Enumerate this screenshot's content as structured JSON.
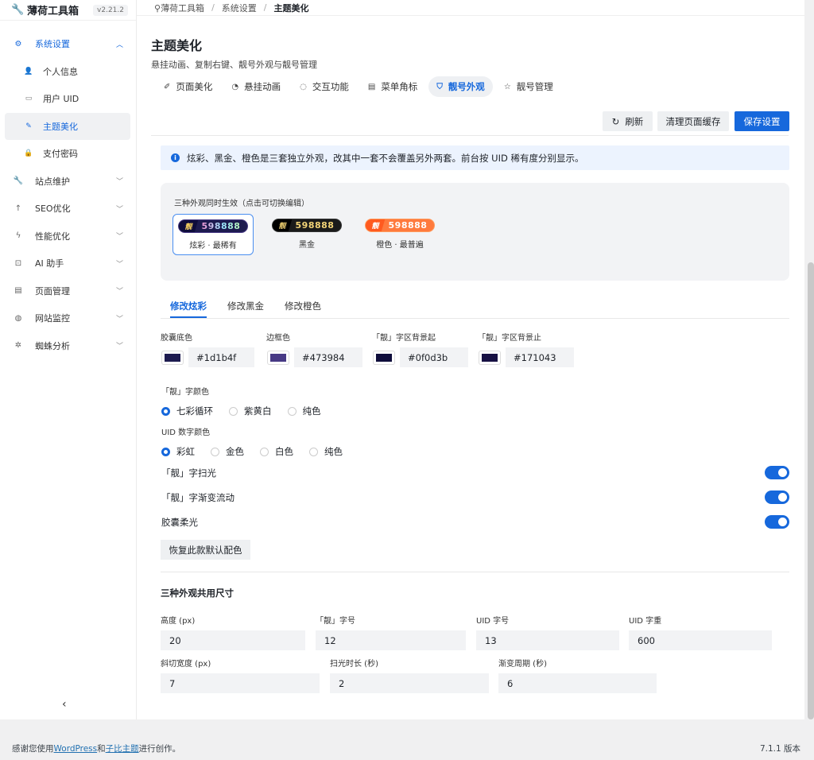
{
  "brand": {
    "name": "薄荷工具箱",
    "version": "v2.21.2",
    "icon": "wrench-icon"
  },
  "sidebar": {
    "items": [
      {
        "label": "系统设置",
        "icon": "gear-icon",
        "open": true
      },
      {
        "label": "站点维护",
        "icon": "wrench-icon"
      },
      {
        "label": "SEO优化",
        "icon": "arrow-up-icon"
      },
      {
        "label": "性能优化",
        "icon": "bolt-icon"
      },
      {
        "label": "AI 助手",
        "icon": "robot-icon"
      },
      {
        "label": "页面管理",
        "icon": "document-icon"
      },
      {
        "label": "网站监控",
        "icon": "globe-icon"
      },
      {
        "label": "蜘蛛分析",
        "icon": "bug-icon"
      }
    ],
    "sub": [
      {
        "label": "个人信息",
        "icon": "user-icon"
      },
      {
        "label": "用户 UID",
        "icon": "id-card-icon"
      },
      {
        "label": "主题美化",
        "icon": "palette-icon",
        "active": true
      },
      {
        "label": "支付密码",
        "icon": "lock-icon"
      }
    ]
  },
  "breadcrumb": {
    "root": "薄荷工具箱",
    "mid": "系统设置",
    "current": "主题美化"
  },
  "page": {
    "title": "主题美化",
    "subtitle": "悬挂动画、复制右键、靓号外观与靓号管理"
  },
  "tabs": [
    {
      "label": "页面美化",
      "icon": "brush-icon"
    },
    {
      "label": "悬挂动画",
      "icon": "swirl-icon"
    },
    {
      "label": "交互功能",
      "icon": "chat-icon"
    },
    {
      "label": "菜单角标",
      "icon": "list-icon"
    },
    {
      "label": "靓号外观",
      "icon": "shirt-icon",
      "active": true
    },
    {
      "label": "靓号管理",
      "icon": "star-icon"
    }
  ],
  "actions": {
    "refresh": "刷新",
    "clear_cache": "清理页面缓存",
    "save": "保存设置"
  },
  "notice": "炫彩、黑金、橙色是三套独立外观，改其中一套不会覆盖另外两套。前台按 UID 稀有度分别显示。",
  "preview": {
    "caption": "三种外观同时生效（点击可切换编辑）",
    "badges": [
      {
        "char": "靓",
        "number": "598888",
        "label": "炫彩 · 最稀有",
        "bg": "#1d1b4f",
        "border": "#473984",
        "char_bg": "#0f0d3b",
        "selected": true
      },
      {
        "char": "靓",
        "number": "598888",
        "label": "黑金",
        "bg": "#1a1a1a",
        "border": "#333333",
        "char_bg": "#000000"
      },
      {
        "char": "靓",
        "number": "598888",
        "label": "橙色 · 最普遍",
        "bg": "#ff7a3d",
        "border": "#ff9a5c",
        "char_bg": "#ff5a1f"
      }
    ]
  },
  "color_tabs": [
    {
      "label": "修改炫彩",
      "active": true
    },
    {
      "label": "修改黑金"
    },
    {
      "label": "修改橙色"
    }
  ],
  "colors": [
    {
      "label": "胶囊底色",
      "value": "#1d1b4f"
    },
    {
      "label": "边框色",
      "value": "#473984"
    },
    {
      "label": "「靓」字区背景起",
      "value": "#0f0d3b"
    },
    {
      "label": "「靓」字区背景止",
      "value": "#171043"
    }
  ],
  "char_color": {
    "label": "「靓」字颜色",
    "options": [
      "七彩循环",
      "紫黄白",
      "纯色"
    ],
    "selected": 0
  },
  "uid_color": {
    "label": "UID 数字颜色",
    "options": [
      "彩虹",
      "金色",
      "白色",
      "纯色"
    ],
    "selected": 0
  },
  "toggles": [
    {
      "label": "「靓」字扫光",
      "on": true
    },
    {
      "label": "「靓」字渐变流动",
      "on": true
    },
    {
      "label": "胶囊柔光",
      "on": true
    }
  ],
  "reset_button": "恢复此款默认配色",
  "sizes": {
    "title": "三种外观共用尺寸",
    "row1": [
      {
        "label": "高度 (px)",
        "value": "20"
      },
      {
        "label": "「靓」字号",
        "value": "12"
      },
      {
        "label": "UID 字号",
        "value": "13"
      },
      {
        "label": "UID 字重",
        "value": "600"
      }
    ],
    "row2": [
      {
        "label": "斜切宽度 (px)",
        "value": "7"
      },
      {
        "label": "扫光时长 (秒)",
        "value": "2"
      },
      {
        "label": "渐变周期 (秒)",
        "value": "6"
      }
    ]
  },
  "footer": {
    "prefix": "感谢您使用",
    "wp_link": "WordPress",
    "and": "和",
    "theme_link": "子比主题",
    "suffix": "进行创作。",
    "version": "7.1.1 版本"
  }
}
